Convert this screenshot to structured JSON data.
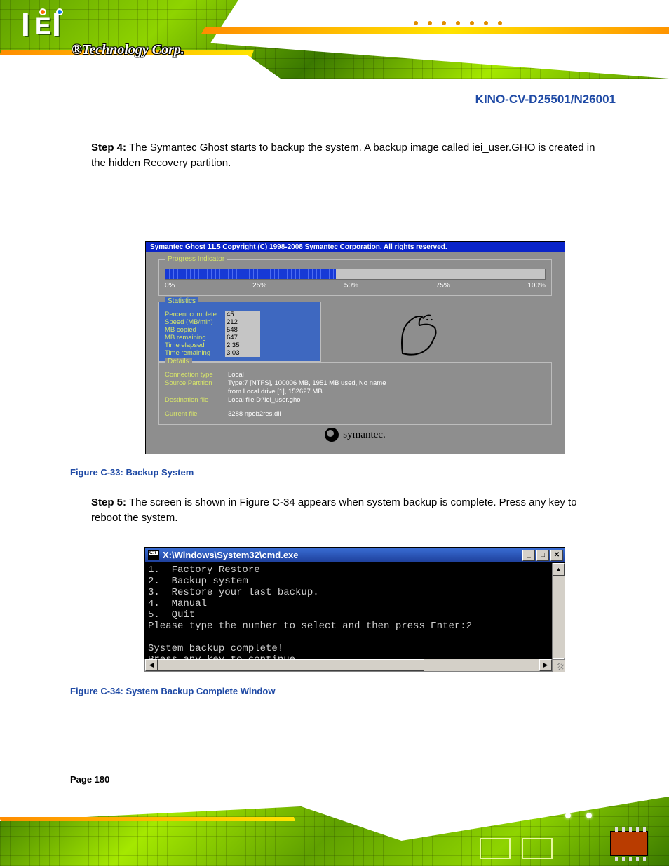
{
  "header": {
    "logo_reg": "®",
    "technology_corp": "Technology Corp."
  },
  "product_title": "KINO-CV-D25501/N26001",
  "steps": {
    "a": {
      "label": "Step 4:",
      "text": "The Symantec Ghost starts to backup the system. A backup image called iei_user.GHO is created in the hidden Recovery partition."
    },
    "b": {
      "label": "Step 5:",
      "text": "The screen is shown in Figure C-34 appears when system backup is complete. Press any key to reboot the system."
    }
  },
  "ghost": {
    "titlebar": "Symantec Ghost 11.5    Copyright (C) 1998-2008 Symantec Corporation. All rights reserved.",
    "groups": {
      "progress": "Progress Indicator",
      "statistics": "Statistics",
      "details": "Details"
    },
    "ticks": {
      "t0": "0%",
      "t25": "25%",
      "t50": "50%",
      "t75": "75%",
      "t100": "100%"
    },
    "progress_percent": 45,
    "stats": {
      "percent_complete": {
        "label": "Percent complete",
        "value": "45"
      },
      "speed": {
        "label": "Speed (MB/min)",
        "value": "212"
      },
      "mb_copied": {
        "label": "MB copied",
        "value": "548"
      },
      "mb_remaining": {
        "label": "MB remaining",
        "value": "647"
      },
      "time_elapsed": {
        "label": "Time elapsed",
        "value": "2:35"
      },
      "time_remaining": {
        "label": "Time remaining",
        "value": "3:03"
      }
    },
    "details": {
      "conn_type": {
        "label": "Connection type",
        "value": "Local"
      },
      "src_part": {
        "label": "Source Partition",
        "value1": "Type:7 [NTFS], 100006 MB, 1951 MB used, No name",
        "value2": "from Local drive [1], 152627 MB"
      },
      "dest_file": {
        "label": "Destination file",
        "value": "Local file D:\\iei_user.gho"
      },
      "cur_file": {
        "label": "Current file",
        "value": "3288 npob2res.dll"
      }
    },
    "symantec": "symantec."
  },
  "fig_caption_1": "Figure C-33: Backup System",
  "cmd": {
    "title": "X:\\Windows\\System32\\cmd.exe",
    "lines": {
      "l1": "1.  Factory Restore",
      "l2": "2.  Backup system",
      "l3": "3.  Restore your last backup.",
      "l4": "4.  Manual",
      "l5": "5.  Quit",
      "l6": "Please type the number to select and then press Enter:2",
      "l7": "",
      "l8": "System backup complete!",
      "l9": "Press any key to continue . . ."
    },
    "btn_min": "_",
    "btn_max": "□",
    "btn_close": "✕",
    "arrow_up": "▲",
    "arrow_down": "▼",
    "arrow_left": "◀",
    "arrow_right": "▶",
    "icon_label": "C:\\"
  },
  "fig_caption_2": "Figure C-34: System Backup Complete Window",
  "page_number": "Page 180"
}
